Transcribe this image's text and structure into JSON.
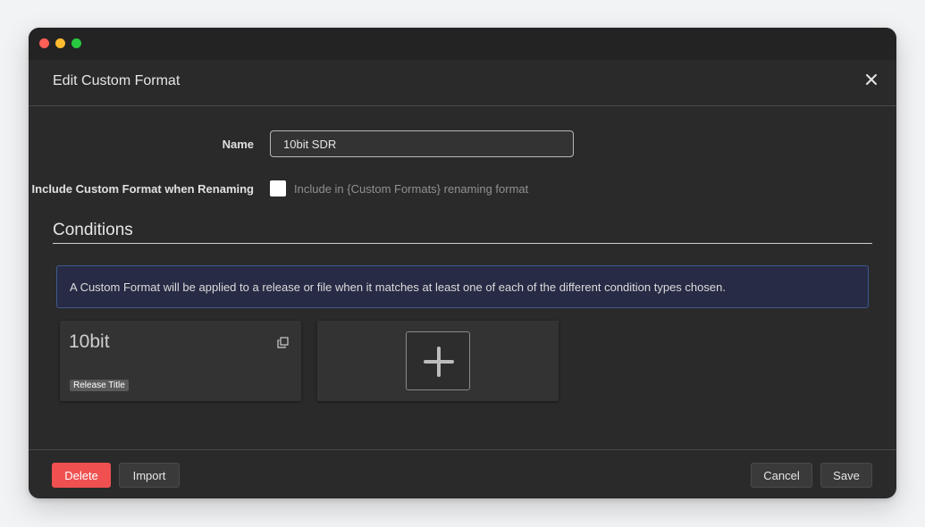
{
  "modal": {
    "title": "Edit Custom Format",
    "icons": {
      "close": "close-icon",
      "clone": "clone-icon",
      "add": "plus-icon"
    }
  },
  "form": {
    "name_label": "Name",
    "name_value": "10bit SDR",
    "rename_label": "Include Custom Format when Renaming",
    "rename_checked": false,
    "rename_help": "Include in {Custom Formats} renaming format"
  },
  "conditions": {
    "heading": "Conditions",
    "info": "A Custom Format will be applied to a release or file when it matches at least one of each of the different condition types chosen.",
    "items": [
      {
        "name": "10bit",
        "tag": "Release Title"
      }
    ]
  },
  "footer": {
    "delete_label": "Delete",
    "import_label": "Import",
    "cancel_label": "Cancel",
    "save_label": "Save"
  },
  "colors": {
    "delete_button": "#f05050",
    "info_background": "#272b45",
    "info_border": "#3f5a8e",
    "modal_background": "#2a2a2a"
  }
}
